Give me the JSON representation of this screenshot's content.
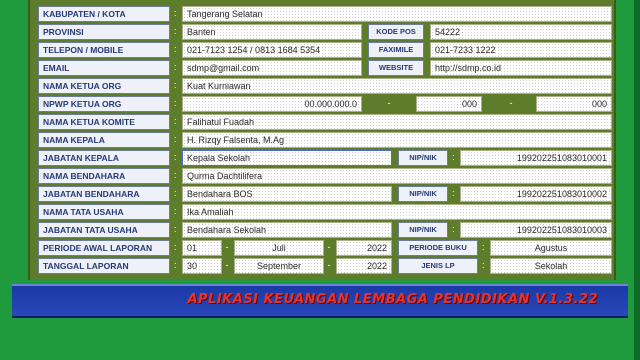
{
  "form": {
    "kabupaten": {
      "label": "KABUPATEN / KOTA",
      "value": "Tangerang Selatan"
    },
    "provinsi": {
      "label": "PROVINSI",
      "value": "Banten",
      "kodepos_label": "KODE POS",
      "kodepos_value": "54222"
    },
    "telepon": {
      "label": "TELEPON / MOBILE",
      "value": "021-7123 1254 / 0813 1684 5354",
      "fax_label": "FAXIMILE",
      "fax_value": "021-7233 1222"
    },
    "email": {
      "label": "EMAIL",
      "value": "sdmp@gmail.com",
      "website_label": "WEBSITE",
      "website_value": "http://sdmp.co.id"
    },
    "ketua_org": {
      "label": "NAMA KETUA ORG",
      "value": "Kuat Kurniawan"
    },
    "npwp": {
      "label": "NPWP KETUA ORG",
      "part1": "00.000.000.0",
      "part2": "000",
      "part3": "000"
    },
    "ketua_komite": {
      "label": "NAMA KETUA KOMITE",
      "value": "Falihatul Fuadah"
    },
    "kepala": {
      "label": "NAMA KEPALA",
      "value": "H. Rizqy Falsenta, M.Ag"
    },
    "jabatan_kepala": {
      "label": "JABATAN KEPALA",
      "value": "Kepala Sekolah",
      "nip_label": "NIP/NIK",
      "nip_value": "199202251083010001"
    },
    "bendahara": {
      "label": "NAMA BENDAHARA",
      "value": "Qurma Dachtilifera"
    },
    "jabatan_bendahara": {
      "label": "JABATAN BENDAHARA",
      "value": "Bendahara BOS",
      "nip_label": "NIP/NIK",
      "nip_value": "199202251083010002"
    },
    "tata_usaha": {
      "label": "NAMA TATA USAHA",
      "value": "Ika Amaliah"
    },
    "jabatan_tu": {
      "label": "JABATAN TATA USAHA",
      "value": "Bendahara Sekolah",
      "nip_label": "NIP/NIK",
      "nip_value": "199202251083010003"
    },
    "periode_awal": {
      "label": "PERIODE AWAL LAPORAN",
      "day": "01",
      "month": "Juli",
      "year": "2022",
      "buku_label": "PERIODE BUKU",
      "buku_value": "Agustus"
    },
    "tanggal": {
      "label": "TANGGAL LAPORAN",
      "day": "30",
      "month": "September",
      "year": "2022",
      "jenis_label": "JENIS LP",
      "jenis_value": "Sekolah"
    }
  },
  "banner": {
    "text": "APLIKASI KEUANGAN LEMBAGA PENDIDIKAN V.1.3.22"
  },
  "colors": {
    "background": "#1f9a3c",
    "panel": "#5e7d2c",
    "banner": "#1b3aa6",
    "banner_text": "#e8322c",
    "label_text": "#263a7a"
  }
}
